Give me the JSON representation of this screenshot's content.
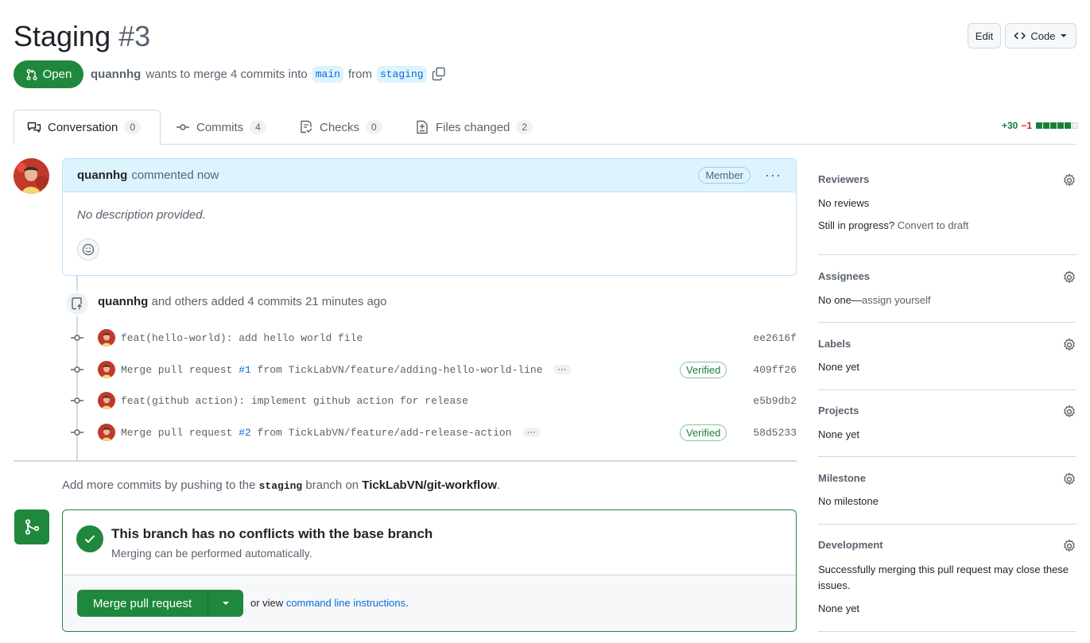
{
  "header": {
    "title": "Staging",
    "number": "#3",
    "edit_label": "Edit",
    "code_label": "Code"
  },
  "state": {
    "label": "Open",
    "color": "#1f883d"
  },
  "meta": {
    "author": "quannhg",
    "text_merge": "wants to merge 4 commits into",
    "base_branch": "main",
    "text_from": "from",
    "head_branch": "staging"
  },
  "tabs": [
    {
      "label": "Conversation",
      "count": "0",
      "icon": "comment-discussion-icon"
    },
    {
      "label": "Commits",
      "count": "4",
      "icon": "git-commit-icon"
    },
    {
      "label": "Checks",
      "count": "0",
      "icon": "checklist-icon"
    },
    {
      "label": "Files changed",
      "count": "2",
      "icon": "file-diff-icon"
    }
  ],
  "diffstat": {
    "additions": "+30",
    "deletions": "−1",
    "boxes": [
      "green",
      "green",
      "green",
      "green",
      "green",
      "gray"
    ]
  },
  "comment": {
    "author": "quannhg",
    "time": "commented now",
    "role": "Member",
    "body": "No description provided."
  },
  "timeline": {
    "author": "quannhg",
    "text": "and others added 4 commits 21 minutes ago",
    "commits": [
      {
        "prefix": "feat(hello-world): add hello world file",
        "pr": "",
        "suffix": "",
        "verified": "",
        "sha": "ee2616f",
        "more": false
      },
      {
        "prefix": "Merge pull request ",
        "pr": "#1",
        "suffix": " from TickLabVN/feature/adding-hello-world-line",
        "verified": "Verified",
        "sha": "409ff26",
        "more": true
      },
      {
        "prefix": "feat(github action): implement github action for release",
        "pr": "",
        "suffix": "",
        "verified": "",
        "sha": "e5b9db2",
        "more": false
      },
      {
        "prefix": "Merge pull request ",
        "pr": "#2",
        "suffix": " from TickLabVN/feature/add-release-action",
        "verified": "Verified",
        "sha": "58d5233",
        "more": true
      }
    ]
  },
  "push_hint": {
    "before": "Add more commits by pushing to the",
    "branch": "staging",
    "middle": "branch on",
    "repo": "TickLabVN/git-workflow",
    "after": "."
  },
  "merge_box": {
    "title": "This branch has no conflicts with the base branch",
    "subtitle": "Merging can be performed automatically.",
    "button": "Merge pull request",
    "or_view": "or view",
    "link": "command line instructions",
    "after": "."
  },
  "sidebar": {
    "reviewers": {
      "title": "Reviewers",
      "value": "No reviews",
      "draft_prefix": "Still in progress?",
      "draft_link": "Convert to draft"
    },
    "assignees": {
      "title": "Assignees",
      "value": "No one—",
      "link": "assign yourself"
    },
    "labels": {
      "title": "Labels",
      "value": "None yet"
    },
    "projects": {
      "title": "Projects",
      "value": "None yet"
    },
    "milestone": {
      "title": "Milestone",
      "value": "No milestone"
    },
    "development": {
      "title": "Development",
      "text": "Successfully merging this pull request may close these issues.",
      "value": "None yet"
    }
  }
}
